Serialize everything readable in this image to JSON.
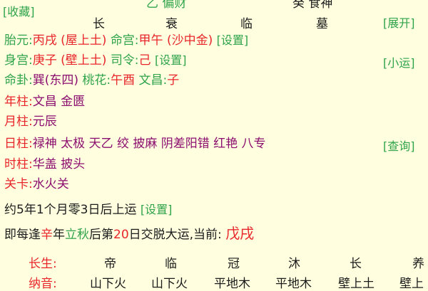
{
  "top": {
    "collect_label": "[收藏]",
    "expand_label": "[展开]",
    "partial_left": "乙 偏财",
    "partial_right": "癸 食神",
    "shensha_cells": [
      "长",
      "衰",
      "临",
      "墓"
    ]
  },
  "rows": {
    "taiyuan": {
      "label": "胎元:",
      "value": "丙戌 (屋上土)",
      "label2": "命宫:",
      "value2": "甲午 (沙中金)",
      "set_label": "[设置]"
    },
    "shengong": {
      "label": "身宫:",
      "value": "庚子 (壁上土)",
      "label2": "司令:",
      "value2": "己",
      "set_label": "[设置]",
      "luck_label": "[小运]"
    },
    "minggua": {
      "label": "命卦:",
      "value": "巽(东四)",
      "label2": "桃花:",
      "value2": "午酉",
      "label3": "文昌:",
      "value3": "子"
    },
    "nianzhu": {
      "label": "年柱:",
      "value": "文昌 金匮"
    },
    "yuezhu": {
      "label": "月柱:",
      "value": "元辰"
    },
    "rizhu": {
      "label": "日柱:",
      "value": "禄神 太极 天乙 绞 披麻 阴差阳错 红艳 八专",
      "query_label": "[查询]"
    },
    "shizhu": {
      "label": "时柱:",
      "value": "华盖 披头"
    },
    "guanka": {
      "label": "关卡:",
      "value": "水火关"
    }
  },
  "qiyun": {
    "text": "约5年1个月零3日后上运",
    "set_label": "[设置]"
  },
  "jiaoyun": {
    "pre": "即每逢",
    "hl1": "辛",
    "mid1": "年",
    "hl2": "立秋",
    "mid2": "后第",
    "hl3": "20",
    "mid3": "日交脱大运,当前:",
    "current": "戊戌"
  },
  "changsheng": {
    "label": "长生:",
    "cells": [
      "帝",
      "临",
      "冠",
      "沐",
      "长",
      "养"
    ]
  },
  "nayin": {
    "label": "纳音:",
    "cells": [
      "山下火",
      "山下火",
      "平地木",
      "平地木",
      "壁上土",
      "壁上"
    ]
  },
  "colors": {
    "background": "#FFFFE0",
    "red": "#E8262A",
    "green": "#2FA34A",
    "purple": "#8B0D6E"
  }
}
